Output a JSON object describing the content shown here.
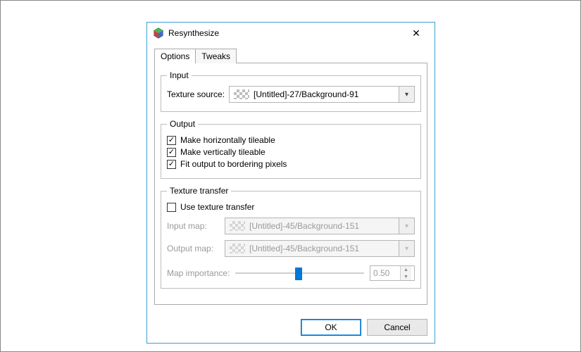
{
  "titlebar": {
    "title": "Resynthesize"
  },
  "tabs": {
    "options": "Options",
    "tweaks": "Tweaks"
  },
  "input_group": {
    "legend": "Input",
    "texture_source_label": "Texture source:",
    "texture_source_value": "[Untitled]-27/Background-91"
  },
  "output_group": {
    "legend": "Output",
    "horiz_label": "Make horizontally tileable",
    "vert_label": "Make vertically tileable",
    "fit_label": "Fit output to bordering pixels",
    "horiz_checked": true,
    "vert_checked": true,
    "fit_checked": true
  },
  "transfer_group": {
    "legend": "Texture transfer",
    "use_label": "Use texture transfer",
    "use_checked": false,
    "input_map_label": "Input map:",
    "input_map_value": "[Untitled]-45/Background-151",
    "output_map_label": "Output map:",
    "output_map_value": "[Untitled]-45/Background-151",
    "importance_label": "Map importance:",
    "importance_value": "0.50",
    "slider_pos_percent": 49
  },
  "buttons": {
    "ok": "OK",
    "cancel": "Cancel"
  },
  "checkmark_glyph": "✓"
}
